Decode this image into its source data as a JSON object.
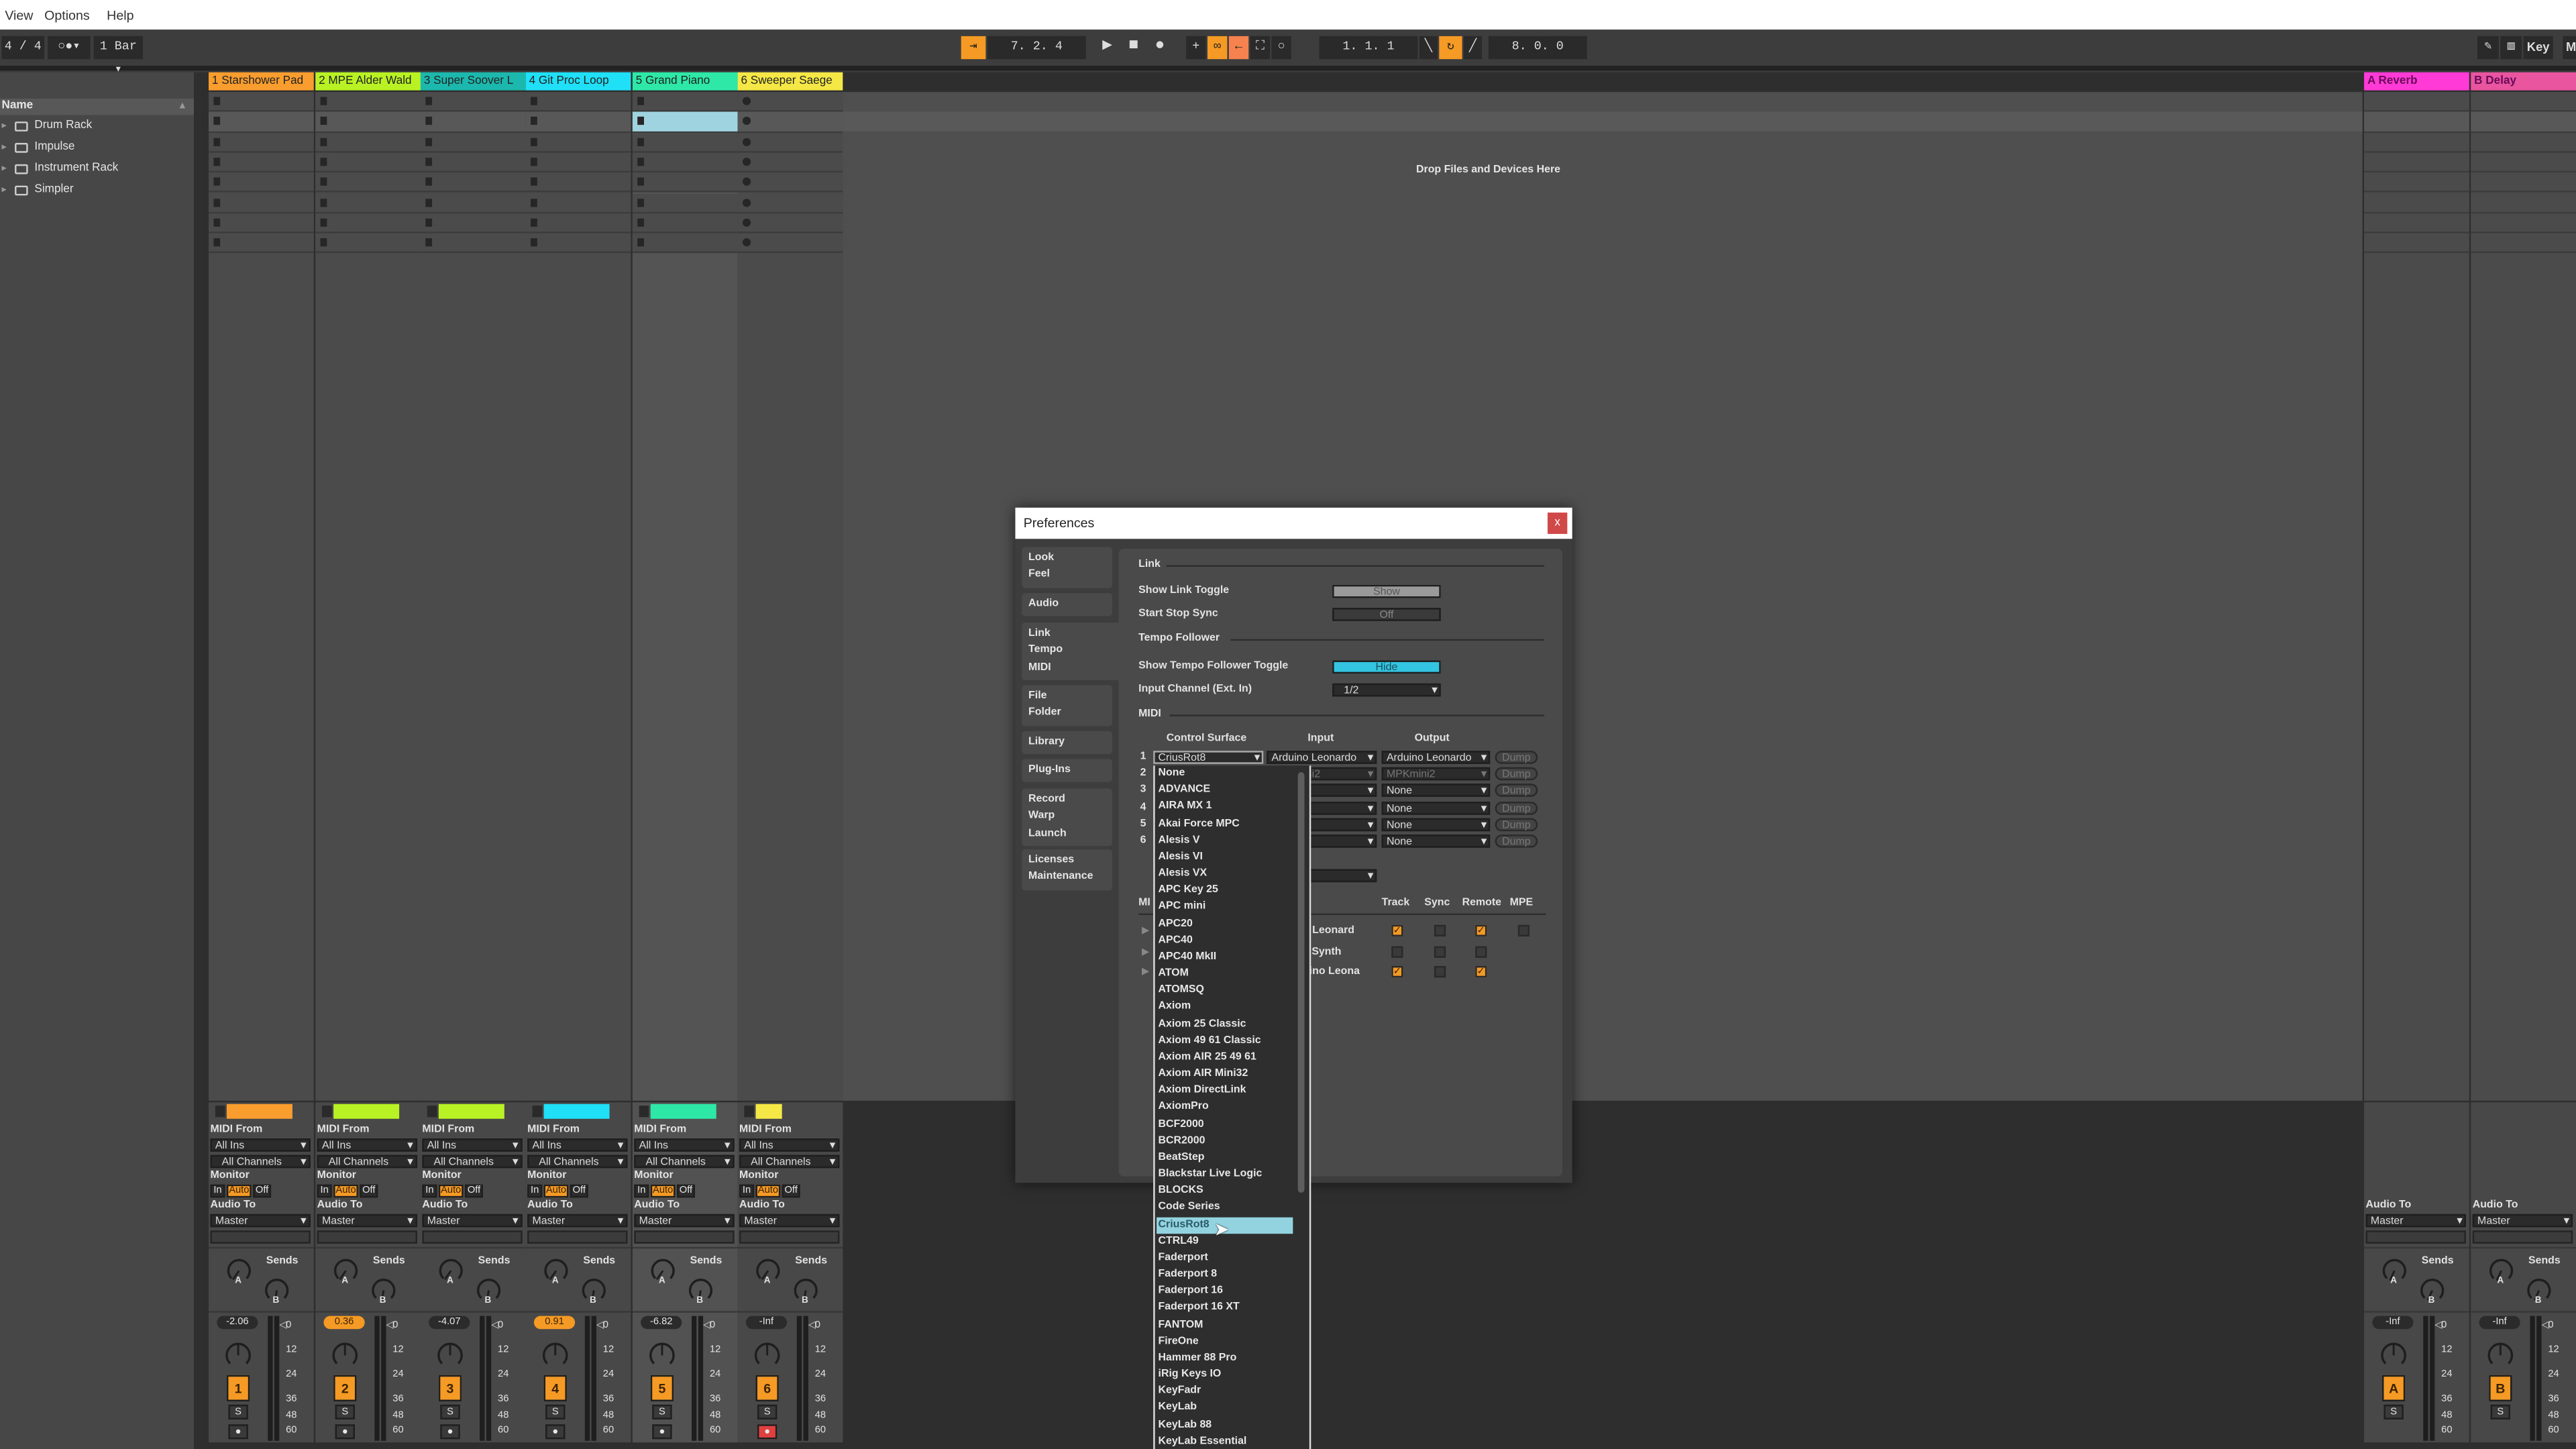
{
  "menu": [
    "View",
    "Options",
    "Help"
  ],
  "toolbar": {
    "time_signature": "4 / 4",
    "metronome": "○●▾",
    "quantize": "1 Bar ▾",
    "arrangement_position": "7. 2. 4",
    "loop_start": "1. 1. 1",
    "loop_length": "8. 0. 0",
    "key_label": "Key",
    "midi_label": "M"
  },
  "browser": {
    "header": "Name",
    "items": [
      "Drum Rack",
      "Impulse",
      "Instrument Rack",
      "Simpler"
    ]
  },
  "drop_hint": "Drop Files and Devices Here",
  "tracks": [
    {
      "name": "1 Starshower Pad",
      "color": "#f99d2e",
      "bar_color": "#f99d2e",
      "number": "1",
      "volume": "-2.06",
      "volume_highlight": false,
      "arm_active": false
    },
    {
      "name": "2 MPE Alder Wald",
      "color": "#b9f224",
      "bar_color": "#b9f224",
      "number": "2",
      "volume": "0.36",
      "volume_highlight": true,
      "arm_active": false
    },
    {
      "name": "3 Super Soover L",
      "color": "#1cb8ad",
      "bar_color": "#b9f224",
      "number": "3",
      "volume": "-4.07",
      "volume_highlight": false,
      "arm_active": false
    },
    {
      "name": "4 Git Proc Loop",
      "color": "#1fe0f7",
      "bar_color": "#1fe0f7",
      "number": "4",
      "volume": "0.91",
      "volume_highlight": true,
      "arm_active": false
    },
    {
      "name": "5 Grand Piano",
      "color": "#2ee8a8",
      "bar_color": "#2ee8a8",
      "number": "5",
      "volume": "-6.82",
      "volume_highlight": false,
      "arm_active": false
    },
    {
      "name": "6 Sweeper Saege",
      "color": "#f5e846",
      "bar_color": "#f5e846",
      "number": "6",
      "volume": "-Inf",
      "volume_highlight": false,
      "arm_active": true
    }
  ],
  "returns": [
    {
      "name": "A Reverb",
      "color": "#ff3ad6",
      "letter": "A",
      "volume": "-Inf"
    },
    {
      "name": "B Delay",
      "color": "#e9559f",
      "letter": "B",
      "volume": "-Inf"
    }
  ],
  "mixer": {
    "midi_from": "MIDI From",
    "all_ins": "All Ins",
    "all_channels": "All Channels",
    "monitor": "Monitor",
    "monitor_in": "In",
    "monitor_auto": "Auto",
    "monitor_off": "Off",
    "audio_to": "Audio To",
    "master": "Master",
    "sends": "Sends",
    "send_a": "A",
    "send_b": "B",
    "solo": "S",
    "meter_scale": [
      "0",
      "12",
      "24",
      "36",
      "48",
      "60"
    ]
  },
  "preferences": {
    "title": "Preferences",
    "close": "x",
    "tabs": [
      {
        "lines": [
          "Look",
          "Feel"
        ]
      },
      {
        "lines": [
          "Audio"
        ]
      },
      {
        "lines": [
          "Link",
          "Tempo",
          "MIDI"
        ]
      },
      {
        "lines": [
          "File",
          "Folder"
        ]
      },
      {
        "lines": [
          "Library"
        ]
      },
      {
        "lines": [
          "Plug-Ins"
        ]
      },
      {
        "lines": [
          "Record",
          "Warp",
          "Launch"
        ]
      },
      {
        "lines": [
          "Licenses",
          "Maintenance"
        ]
      }
    ],
    "link_section": "Link",
    "show_link_toggle": "Show Link Toggle",
    "show_link_toggle_value": "Show",
    "start_stop_sync": "Start Stop Sync",
    "start_stop_sync_value": "Off",
    "tempo_section": "Tempo Follower",
    "show_tempo_toggle": "Show Tempo Follower Toggle",
    "show_tempo_toggle_value": "Hide",
    "input_channel": "Input Channel (Ext. In)",
    "input_channel_value": "1/2",
    "midi_section": "MIDI",
    "col_control_surface": "Control Surface",
    "col_input": "Input",
    "col_output": "Output",
    "surfaces": [
      {
        "num": "1",
        "surface": "CriusRot8",
        "input": "Arduino Leonardo",
        "output": "Arduino Leonardo",
        "dump": "Dump"
      },
      {
        "num": "2",
        "surface": "",
        "input": "MPKmini2",
        "output": "MPKmini2",
        "dump": "Dump"
      },
      {
        "num": "3",
        "surface": "",
        "input": "",
        "output": "None",
        "dump": "Dump"
      },
      {
        "num": "4",
        "surface": "",
        "input": "",
        "output": "None",
        "dump": "Dump"
      },
      {
        "num": "5",
        "surface": "",
        "input": "",
        "output": "None",
        "dump": "Dump"
      },
      {
        "num": "6",
        "surface": "",
        "input": "",
        "output": "None",
        "dump": "Dump"
      }
    ],
    "ports_label": "MI",
    "ports_cols": [
      "Track",
      "Sync",
      "Remote",
      "MPE"
    ],
    "ports": [
      {
        "name": "o Leonard",
        "track": true,
        "sync": false,
        "remote": true,
        "mpe": false
      },
      {
        "name": "e Synth",
        "track": false,
        "sync": false,
        "remote": false
      },
      {
        "name": "uino Leona",
        "track": true,
        "sync": false,
        "remote": true
      }
    ]
  },
  "surface_dropdown": {
    "selected": "CriusRot8",
    "items": [
      "None",
      "ADVANCE",
      "AIRA MX 1",
      "Akai Force MPC",
      "Alesis V",
      "Alesis VI",
      "Alesis VX",
      "APC Key 25",
      "APC mini",
      "APC20",
      "APC40",
      "APC40 MkII",
      "ATOM",
      "ATOMSQ",
      "Axiom",
      "Axiom 25 Classic",
      "Axiom 49 61 Classic",
      "Axiom AIR 25 49 61",
      "Axiom AIR Mini32",
      "Axiom DirectLink",
      "AxiomPro",
      "BCF2000",
      "BCR2000",
      "BeatStep",
      "Blackstar Live Logic",
      "BLOCKS",
      "Code Series",
      "CriusRot8",
      "CTRL49",
      "Faderport",
      "Faderport 8",
      "Faderport 16",
      "Faderport 16 XT",
      "FANTOM",
      "FireOne",
      "Hammer 88 Pro",
      "iRig Keys IO",
      "KeyFadr",
      "KeyLab",
      "KeyLab 88",
      "KeyLab Essential"
    ]
  }
}
